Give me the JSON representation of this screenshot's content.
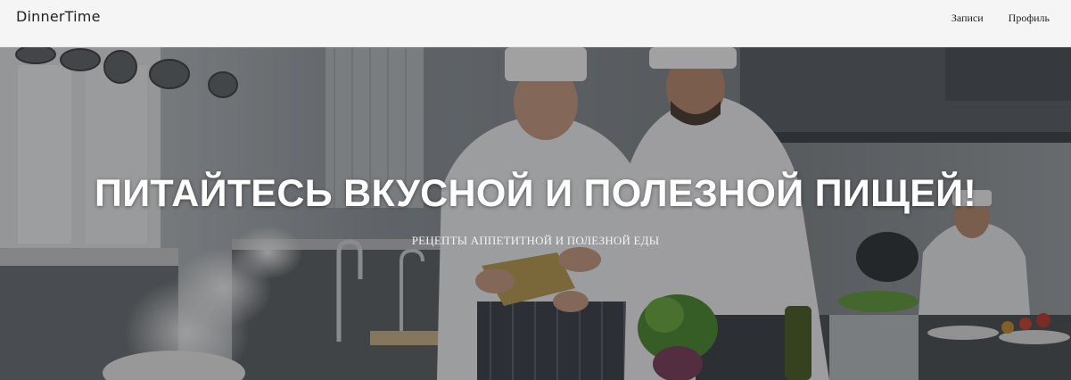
{
  "navbar": {
    "brand": "DinnerTime",
    "links": [
      {
        "label": "Записи"
      },
      {
        "label": "Профиль"
      }
    ]
  },
  "hero": {
    "title": "ПИТАЙТЕСЬ ВКУСНОЙ И ПОЛЕЗНОЙ ПИЩЕЙ!",
    "subtitle": "РЕЦЕПТЫ АППЕТИТНОЙ И ПОЛЕЗНОЙ ЕДЫ",
    "image": "kitchen-chefs-photo"
  }
}
